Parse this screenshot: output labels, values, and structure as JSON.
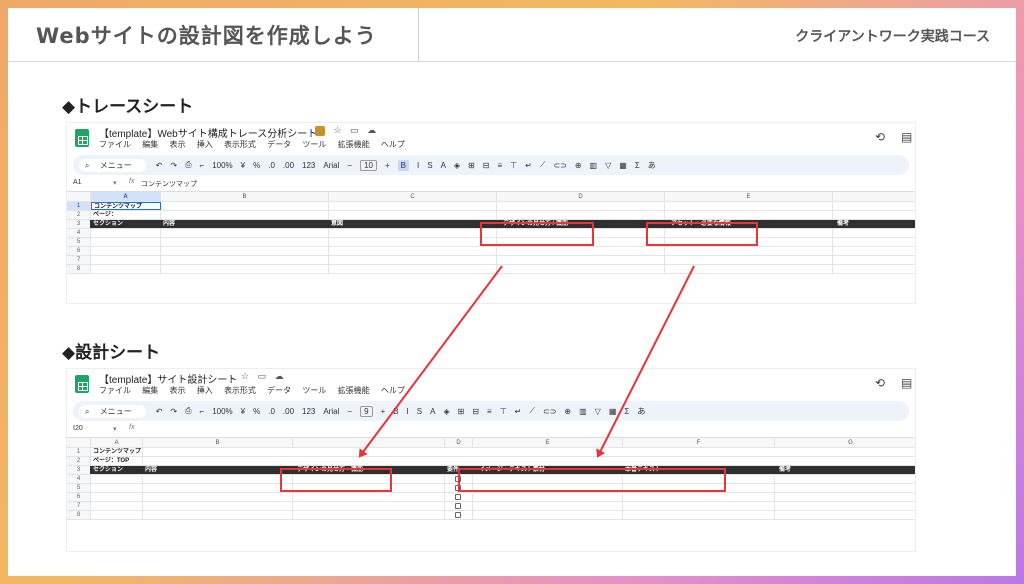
{
  "header": {
    "title": "Webサイトの設計図を作成しよう",
    "course": "クライアントワーク実践コース"
  },
  "sections": {
    "trace_title": "◆トレースシート",
    "design_title": "◆設計シート"
  },
  "colors": {
    "accent_red": "#e8343a",
    "dark_row": "#2f2f2f",
    "sheets_green": "#1fa463"
  },
  "menu_items": [
    "ファイル",
    "編集",
    "表示",
    "挿入",
    "表示形式",
    "データ",
    "ツール",
    "拡張機能",
    "ヘルプ"
  ],
  "toolbar": {
    "search": "メニュー",
    "zoom": "100%",
    "currency": "¥",
    "percent": "%",
    "decrease_decimal": ".0",
    "increase_decimal": ".00",
    "number_format": "123",
    "font": "Arial",
    "minus": "−",
    "plus": "+",
    "bold": "B",
    "italic": "I",
    "strike": "S",
    "text_color": "A",
    "sigma": "Σ",
    "input_tool": "あ"
  },
  "trace_sheet": {
    "doc_title": "【template】Webサイト構成トレース分析シート",
    "font_size": "10",
    "cell_ref": "A1",
    "formula_value": "コンテンツマップ",
    "columns": [
      "A",
      "B",
      "C",
      "D",
      "E",
      "F"
    ],
    "rows": [
      "1",
      "2",
      "3",
      "4",
      "5",
      "6",
      "7",
      "8"
    ],
    "r1_a": "コンテンツマップ",
    "r2_a": "ページ：",
    "header_row": [
      "セクション",
      "内容",
      "意図",
      "デザインの見せ方 / 機能",
      "アセット・必要な情報",
      "備考"
    ]
  },
  "design_sheet": {
    "doc_title": "【template】サイト設計シート",
    "font_size": "9",
    "cell_ref": "I20",
    "formula_value": "",
    "columns": [
      "A",
      "B",
      "",
      "D",
      "E",
      "F",
      "G"
    ],
    "rows": [
      "1",
      "2",
      "3",
      "4",
      "5",
      "6",
      "7",
      "8"
    ],
    "r1_a": "コンテンツマップ",
    "r2_a": "ページ：TOP",
    "header_row": [
      "セクション",
      "内容",
      "デザインの見せ方・機能",
      "要件",
      "イメージ・テキスト素材",
      "本番テキスト",
      "備考"
    ]
  }
}
